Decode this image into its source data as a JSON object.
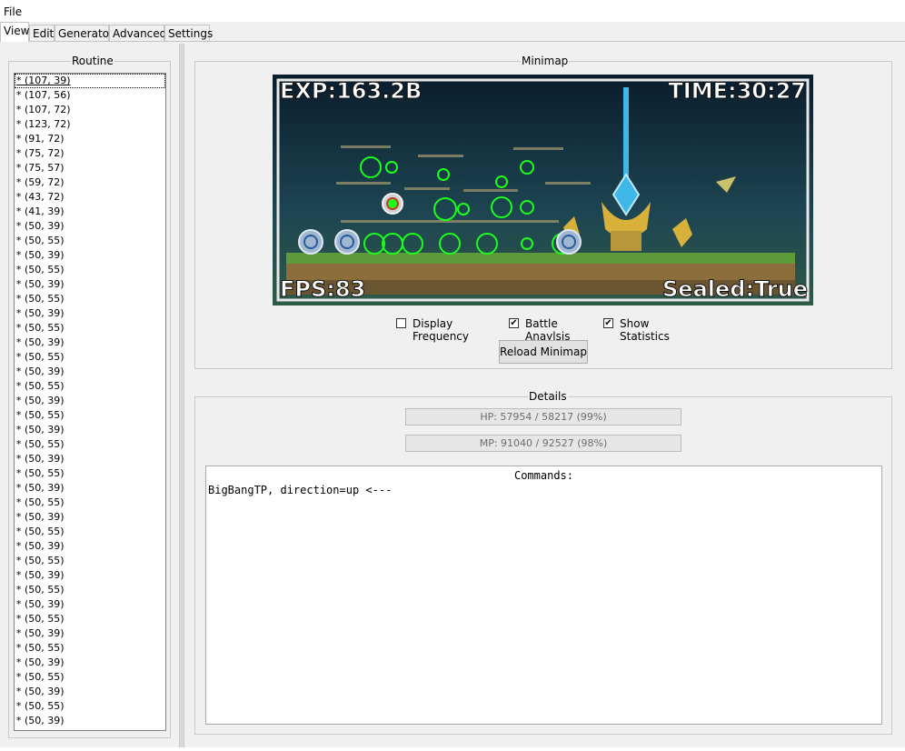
{
  "menu": {
    "file": "File"
  },
  "tabs": [
    "View",
    "Edit",
    "Generator",
    "Advanced",
    "Settings"
  ],
  "routine": {
    "title": "Routine",
    "items": [
      "* (107, 39)",
      "* (107, 56)",
      "* (107, 72)",
      "* (123, 72)",
      "* (91, 72)",
      "* (75, 72)",
      "* (75, 57)",
      "* (59, 72)",
      "* (43, 72)",
      "* (41, 39)",
      "* (50, 39)",
      "* (50, 55)",
      "* (50, 39)",
      "* (50, 55)",
      "* (50, 39)",
      "* (50, 55)",
      "* (50, 39)",
      "* (50, 55)",
      "* (50, 39)",
      "* (50, 55)",
      "* (50, 39)",
      "* (50, 55)",
      "* (50, 39)",
      "* (50, 55)",
      "* (50, 39)",
      "* (50, 55)",
      "* (50, 39)",
      "* (50, 55)",
      "* (50, 39)",
      "* (50, 55)",
      "* (50, 39)",
      "* (50, 55)",
      "* (50, 39)",
      "* (50, 55)",
      "* (50, 39)",
      "* (50, 55)",
      "* (50, 39)",
      "* (50, 55)",
      "* (50, 39)",
      "* (50, 55)",
      "* (50, 39)",
      "* (50, 55)",
      "* (50, 39)",
      "* (50, 55)",
      "* (50, 39)"
    ]
  },
  "minimap": {
    "title": "Minimap",
    "exp": "EXP:163.2B",
    "time": "TIME:30:27",
    "fps": "FPS:83",
    "sealed": "Sealed:True",
    "options": [
      {
        "label": "Display Frequency",
        "checked": false
      },
      {
        "label": "Battle Anaylsis",
        "checked": true
      },
      {
        "label": "Show Statistics",
        "checked": true
      }
    ],
    "reload_label": "Reload Minimap"
  },
  "details": {
    "title": "Details",
    "hp": {
      "text": "HP: 57954 / 58217 (99%)",
      "fraction": 0.99
    },
    "mp": {
      "text": "MP: 91040 / 92527 (98%)",
      "fraction": 0.98
    },
    "commands_title": "Commands:",
    "command_line": "BigBangTP, direction=up <---"
  },
  "colors": {
    "marker": "#1aff1a",
    "crystal": "#3fb8e8",
    "gold": "#d8b13a",
    "ground": "#5c9a3a"
  }
}
